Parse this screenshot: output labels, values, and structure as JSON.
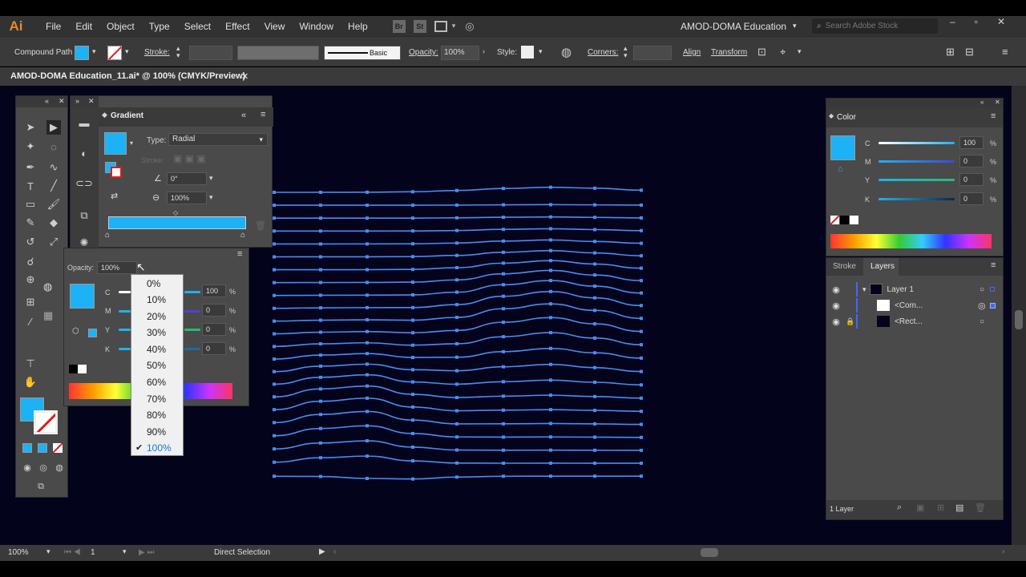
{
  "app": {
    "logo": "Ai"
  },
  "menu": [
    "File",
    "Edit",
    "Object",
    "Type",
    "Select",
    "Effect",
    "View",
    "Window",
    "Help"
  ],
  "menubar_icons": [
    "Br",
    "St"
  ],
  "workspace": "AMOD-DOMA Education",
  "search_placeholder": "Search Adobe Stock",
  "control": {
    "selection": "Compound Path",
    "stroke_label": "Stroke:",
    "brush": "Basic",
    "opacity_label": "Opacity:",
    "opacity_value": "100%",
    "style_label": "Style:",
    "corners_label": "Corners:",
    "align": "Align",
    "transform": "Transform"
  },
  "document_tab": "AMOD-DOMA Education_11.ai* @ 100% (CMYK/Preview)",
  "gradient_panel": {
    "title": "Gradient",
    "type_label": "Type:",
    "type_value": "Radial",
    "stroke_label": "Stroke:",
    "angle": "0°",
    "aspect": "100%"
  },
  "color_panel_left": {
    "opacity_label": "Opacity:",
    "opacity_value": "100%",
    "channels": [
      {
        "label": "C",
        "value": "100"
      },
      {
        "label": "M",
        "value": "0"
      },
      {
        "label": "Y",
        "value": "0"
      },
      {
        "label": "K",
        "value": "0"
      }
    ],
    "pct": "%"
  },
  "opacity_dropdown": {
    "options": [
      "0%",
      "10%",
      "20%",
      "30%",
      "40%",
      "50%",
      "60%",
      "70%",
      "80%",
      "90%",
      "100%"
    ],
    "selected": "100%"
  },
  "color_panel": {
    "title": "Color",
    "channels": [
      {
        "label": "C",
        "value": "100"
      },
      {
        "label": "M",
        "value": "0"
      },
      {
        "label": "Y",
        "value": "0"
      },
      {
        "label": "K",
        "value": "0"
      }
    ],
    "pct": "%"
  },
  "layers_panel": {
    "tabs": [
      "Stroke",
      "Layers"
    ],
    "rows": [
      {
        "name": "Layer 1"
      },
      {
        "name": "<Com..."
      },
      {
        "name": "<Rect..."
      }
    ],
    "footer": "1 Layer"
  },
  "status": {
    "zoom": "100%",
    "artboard": "1",
    "tool": "Direct Selection"
  },
  "colors": {
    "accent": "#1cb2f5",
    "line": "#4a8cf0",
    "canvas": "#03031c"
  }
}
